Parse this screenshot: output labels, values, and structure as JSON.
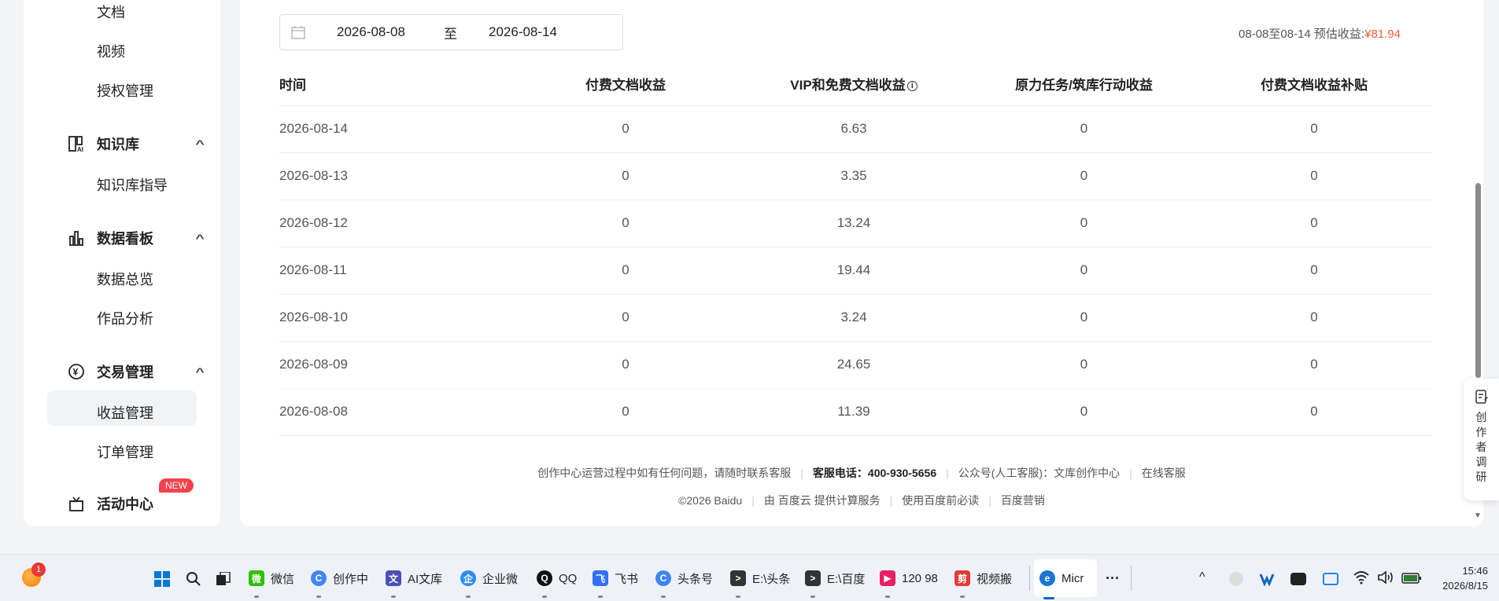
{
  "sidebar": {
    "top_items": [
      {
        "label": "文档"
      },
      {
        "label": "视频"
      },
      {
        "label": "授权管理"
      }
    ],
    "knowledge": {
      "label": "知识库",
      "items": [
        "知识库指导"
      ]
    },
    "data_board": {
      "label": "数据看板",
      "items": [
        "数据总览",
        "作品分析"
      ]
    },
    "trade": {
      "label": "交易管理",
      "items": [
        "收益管理",
        "订单管理"
      ]
    },
    "activity": {
      "label": "活动中心",
      "badge": "NEW"
    }
  },
  "filter": {
    "start_date": "2026-08-08",
    "separator": "至",
    "end_date": "2026-08-14",
    "estimate_label": "08-08至08-14 预估收益:",
    "estimate_value": "¥81.94"
  },
  "table": {
    "headers": [
      "时间",
      "付费文档收益",
      "VIP和免费文档收益",
      "原力任务/筑库行动收益",
      "付费文档收益补贴"
    ],
    "info_icon": "ⓘ",
    "rows": [
      [
        "2026-08-14",
        "0",
        "6.63",
        "0",
        "0"
      ],
      [
        "2026-08-13",
        "0",
        "3.35",
        "0",
        "0"
      ],
      [
        "2026-08-12",
        "0",
        "13.24",
        "0",
        "0"
      ],
      [
        "2026-08-11",
        "0",
        "19.44",
        "0",
        "0"
      ],
      [
        "2026-08-10",
        "0",
        "3.24",
        "0",
        "0"
      ],
      [
        "2026-08-09",
        "0",
        "24.65",
        "0",
        "0"
      ],
      [
        "2026-08-08",
        "0",
        "11.39",
        "0",
        "0"
      ]
    ]
  },
  "footer": {
    "help_text": "创作中心运营过程中如有任何问题，请随时联系客服",
    "phone": "客服电话：400-930-5656",
    "wechat": "公众号(人工客服)：文库创作中心",
    "online": "在线客服",
    "copyright": "©2026 Baidu",
    "cloud": "由 百度云 提供计算服务",
    "must_read": "使用百度前必读",
    "marketing": "百度营销"
  },
  "survey": {
    "label": "创作者调研"
  },
  "taskbar": {
    "notification_count": "1",
    "apps": [
      {
        "label": "微信",
        "color": "#2dc100",
        "glyph": "微"
      },
      {
        "label": "创作中",
        "color": "#4285f4",
        "glyph": "C"
      },
      {
        "label": "AI文库",
        "color": "#4b4fb5",
        "glyph": "文"
      },
      {
        "label": "企业微",
        "color": "#2b8cf0",
        "glyph": "企"
      },
      {
        "label": "QQ",
        "color": "#111111",
        "glyph": "Q"
      },
      {
        "label": "飞书",
        "color": "#3370ff",
        "glyph": "飞"
      },
      {
        "label": "头条号",
        "color": "#4285f4",
        "glyph": "C"
      },
      {
        "label": "E:\\头条",
        "color": "#333333",
        "glyph": ">"
      },
      {
        "label": "E:\\百度",
        "color": "#333333",
        "glyph": ">"
      },
      {
        "label": "120 98",
        "color": "#e91e63",
        "glyph": "▶"
      },
      {
        "label": "视频搬",
        "color": "#e53935",
        "glyph": "剪"
      },
      {
        "label": "Micr",
        "color": "#1976d2",
        "glyph": "e"
      }
    ],
    "more": "···",
    "time": "15:46",
    "date": "2026/8/15"
  }
}
